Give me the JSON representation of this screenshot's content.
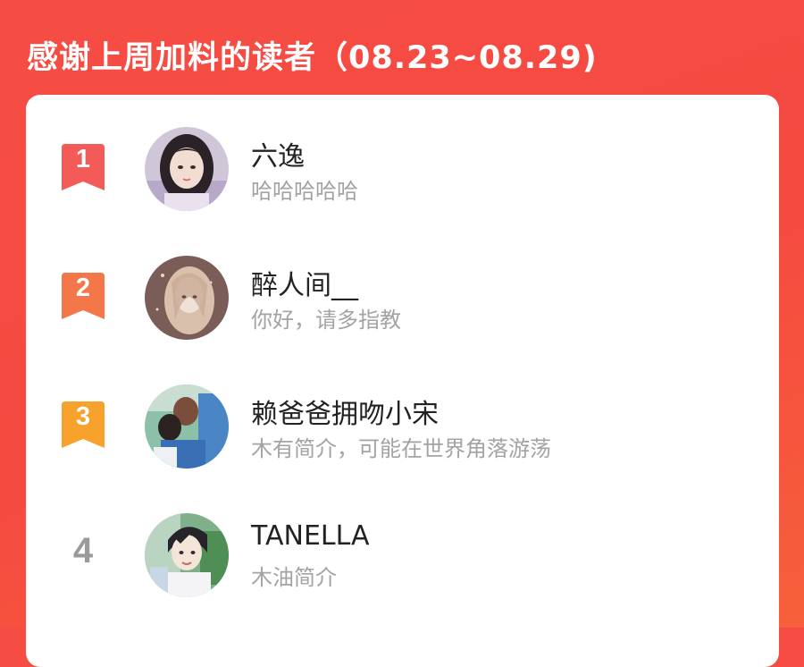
{
  "header": {
    "title": "感谢上周加料的读者（08.23~08.29)"
  },
  "colors": {
    "background": "#f54c44",
    "card": "#ffffff",
    "rank1": "#f25b57",
    "rank2": "#f4774a",
    "rank3": "#f7a22c",
    "name_text": "#222222",
    "bio_text": "#a3a3a3",
    "rank_plain": "#9a9a9a"
  },
  "readers": [
    {
      "rank": "1",
      "name": "六逸",
      "bio": "哈哈哈哈哈",
      "avatar_icon": "avatar-girl-photo"
    },
    {
      "rank": "2",
      "name": "醉人间__",
      "bio": "你好，请多指教",
      "avatar_icon": "avatar-anime-girl"
    },
    {
      "rank": "3",
      "name": "赖爸爸拥吻小宋",
      "bio": "木有简介，可能在世界角落游荡",
      "avatar_icon": "avatar-hug-photo"
    },
    {
      "rank": "4",
      "name": "TANELLA",
      "bio": "木油简介",
      "avatar_icon": "avatar-anime-boy"
    }
  ]
}
